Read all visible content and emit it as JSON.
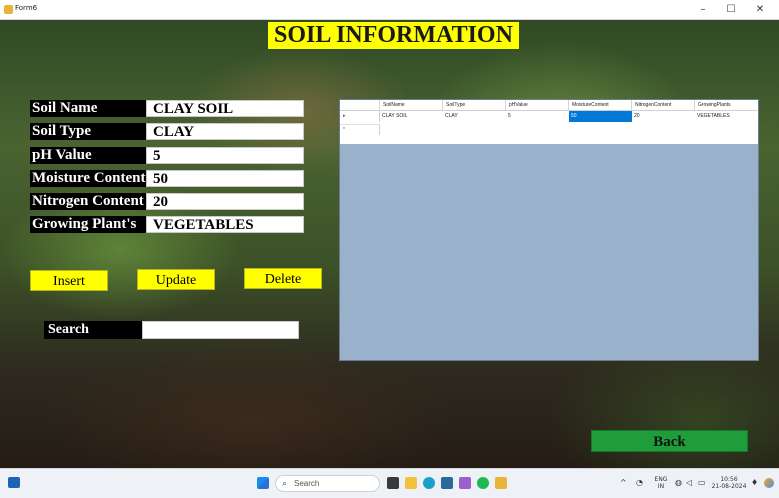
{
  "window": {
    "title": "Form6",
    "controls": {
      "minimize": "–",
      "maximize": "☐",
      "close": "✕"
    }
  },
  "heading": "SOIL INFORMATION",
  "form": {
    "fields": [
      {
        "label": "Soil Name",
        "value": "CLAY SOIL"
      },
      {
        "label": "Soil Type",
        "value": "CLAY"
      },
      {
        "label": "pH Value",
        "value": "5"
      },
      {
        "label": "Moisture Content",
        "value": "50"
      },
      {
        "label": "Nitrogen Content",
        "value": "20"
      },
      {
        "label": "Growing Plant's",
        "value": "VEGETABLES"
      }
    ]
  },
  "buttons": {
    "insert": "Insert",
    "update": "Update",
    "delete": "Delete",
    "back": "Back"
  },
  "search": {
    "label": "Search",
    "value": ""
  },
  "grid": {
    "columns": [
      "SoilName",
      "SoilType",
      "pHValue",
      "MoistureContent",
      "NitrogenContent",
      "GrowingPlants"
    ],
    "rows": [
      [
        "CLAY SOIL",
        "CLAY",
        "5",
        "50",
        "20",
        "VEGETABLES"
      ]
    ],
    "current_row_marker": "▸",
    "new_row_marker": "*",
    "selected_cell": {
      "row": 0,
      "column": 3
    },
    "colors": {
      "background": "#9ab1cc",
      "selection": "#0078d7"
    }
  },
  "taskbar": {
    "search_placeholder": "Search",
    "tray": {
      "language": "ENG",
      "region": "IN",
      "time": "10:56",
      "date": "21-08-2024"
    }
  },
  "colors": {
    "accent_yellow": "#ffff00",
    "back_green": "#1f9d3a"
  }
}
